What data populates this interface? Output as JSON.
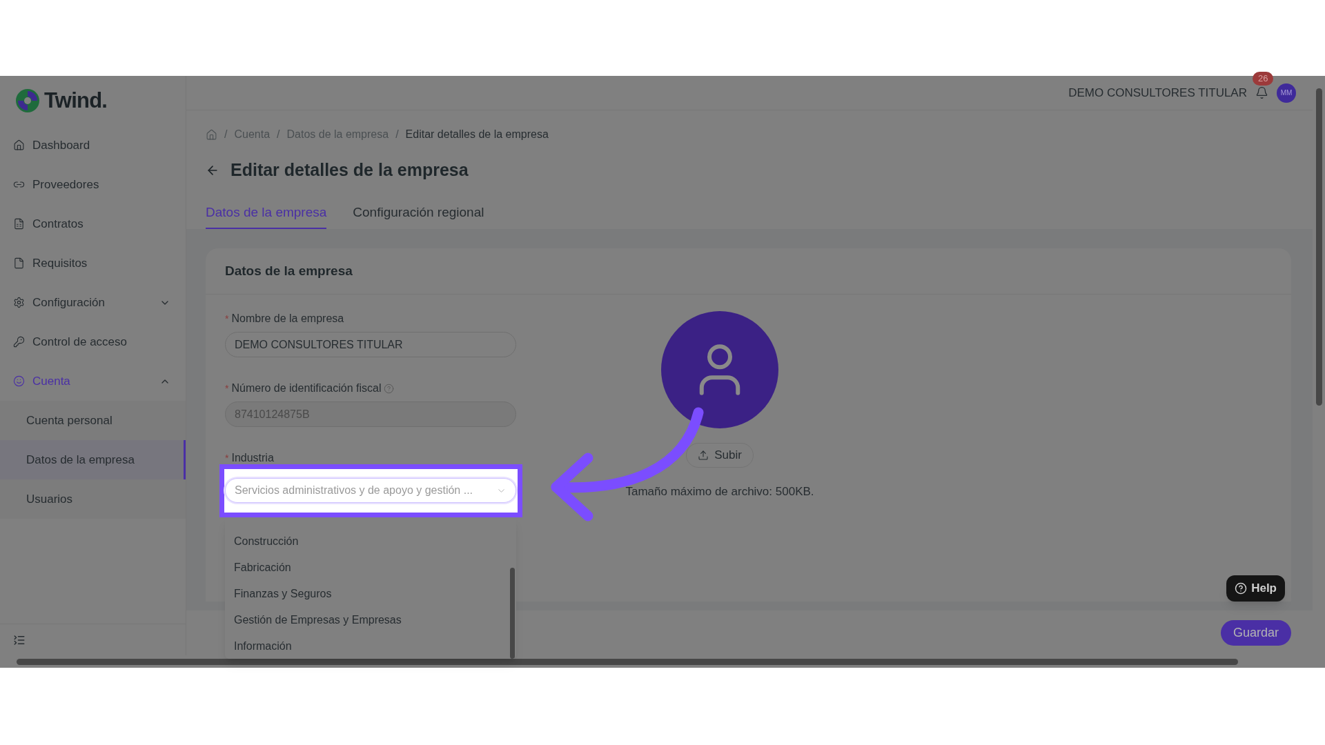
{
  "logo": {
    "text": "Twind."
  },
  "sidebar": {
    "items": [
      {
        "label": "Dashboard",
        "kind": "link",
        "selected": false
      },
      {
        "label": "Proveedores",
        "kind": "link",
        "selected": false
      },
      {
        "label": "Contratos",
        "kind": "link",
        "selected": false
      },
      {
        "label": "Requisitos",
        "kind": "link",
        "selected": false
      },
      {
        "label": "Configuración",
        "kind": "group",
        "selected": false,
        "expanded": false
      },
      {
        "label": "Control de acceso",
        "kind": "link",
        "selected": false
      },
      {
        "label": "Cuenta",
        "kind": "group",
        "selected": true,
        "expanded": true,
        "children": [
          {
            "label": "Cuenta personal",
            "selected": false
          },
          {
            "label": "Datos de la empresa",
            "selected": true
          },
          {
            "label": "Usuarios",
            "selected": false
          }
        ]
      }
    ]
  },
  "header": {
    "account_name": "DEMO CONSULTORES TITULAR",
    "notification_count": "26",
    "user_initials": "MM"
  },
  "breadcrumb": [
    {
      "separator": "/",
      "label": "Cuenta"
    },
    {
      "separator": "/",
      "label": "Datos de la empresa"
    },
    {
      "separator": "/",
      "label": "Editar detalles de la empresa"
    }
  ],
  "page_title": "Editar detalles de la empresa",
  "tabs": [
    {
      "label": "Datos de la empresa",
      "selected": true
    },
    {
      "label": "Configuración regional",
      "selected": false
    }
  ],
  "card": {
    "title": "Datos de la empresa",
    "fields": [
      {
        "kind": "text",
        "label": "Nombre de la empresa",
        "required_mark": "*",
        "value": "DEMO CONSULTORES TITULAR",
        "disabled": false
      },
      {
        "kind": "text",
        "label": "Número de identificación fiscal",
        "required_mark": "*",
        "value": "87410124875B",
        "disabled": true,
        "help": true
      },
      {
        "kind": "select",
        "label": "Industria",
        "required_mark": "*",
        "value": "Servicios administrativos y de apoyo y gestión ...",
        "highlighted": true,
        "expanded": true,
        "options": [
          "Construcción",
          "Fabricación",
          "Finanzas y Seguros",
          "Gestión de Empresas y Empresas",
          "Información"
        ]
      }
    ],
    "upload": {
      "button": "Subir",
      "note": "Tamaño máximo de archivo: 500KB."
    }
  },
  "help_button": "Help",
  "save_button": "Guardar"
}
